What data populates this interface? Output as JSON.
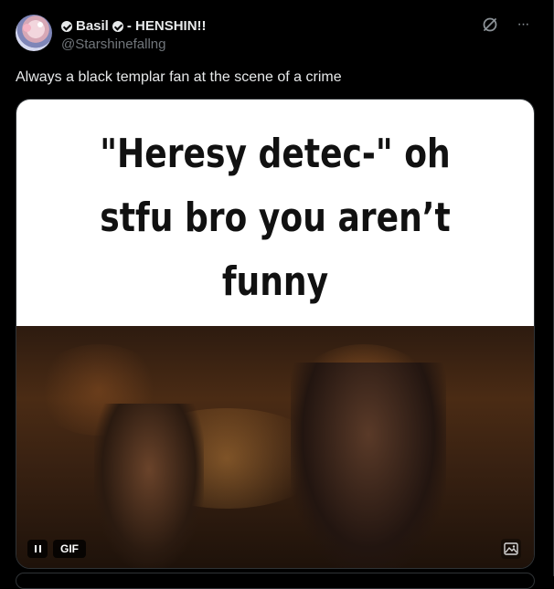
{
  "post": {
    "display_name_1": "Basil",
    "display_name_2": "- HENSHIN!!",
    "handle": "@Starshinefallng",
    "text": "Always a black templar fan at the scene of a crime",
    "more_label": "···"
  },
  "media": {
    "caption_lines": [
      "\"Heresy detec-\" oh",
      "stfu bro you aren’t",
      "funny"
    ],
    "gif_label": "GIF"
  },
  "colors": {
    "background": "#000000",
    "primary_text": "#e7e9ea",
    "secondary_text": "#71767b",
    "border": "#2f3336"
  },
  "icons": {
    "grok": "grok-icon",
    "more": "more-icon",
    "pause": "pause-icon",
    "alt": "alt-image-icon",
    "badge": "verified-badge-icon"
  }
}
